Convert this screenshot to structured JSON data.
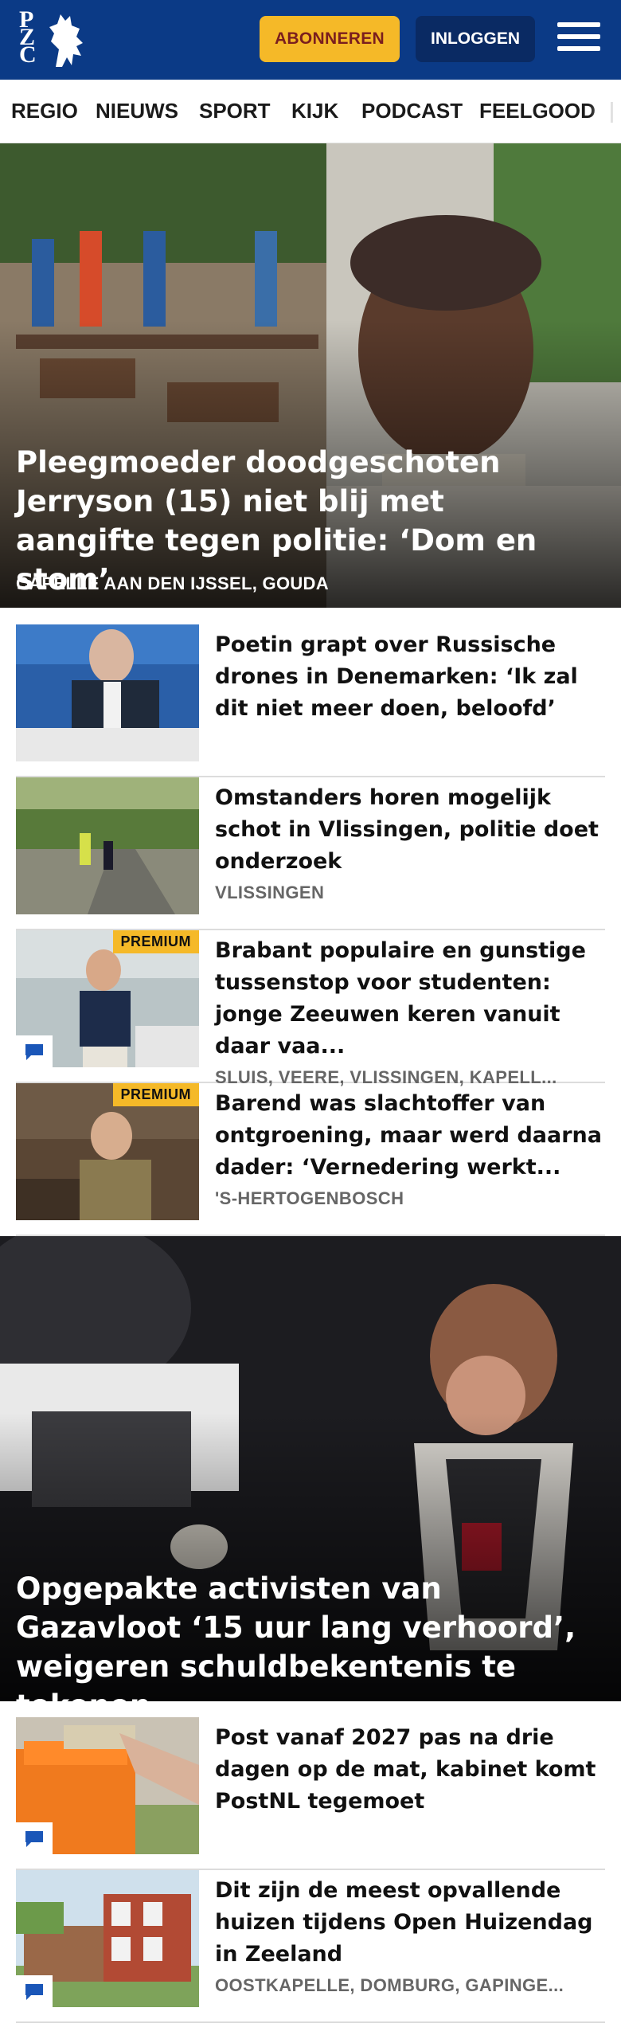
{
  "header": {
    "logo_text": "PZC",
    "subscribe_label": "ABONNEREN",
    "login_label": "INLOGGEN",
    "menu_icon": "hamburger-menu-icon",
    "colors": {
      "brand": "#0b3a86",
      "accent": "#f5b928"
    }
  },
  "nav": {
    "items": [
      "REGIO",
      "NIEUWS",
      "SPORT",
      "KIJK",
      "PODCAST",
      "FEELGOOD"
    ]
  },
  "hero1": {
    "headline": "Pleegmoeder doodgeschoten Jerryson (15) niet blij met aangifte tegen politie: ‘Dom en stom’",
    "location": "CAPELLE AAN DEN IJSSEL, GOUDA"
  },
  "articles": [
    {
      "title": "Poetin grapt over Russische drones in Denemarken: ‘Ik zal dit niet meer doen, beloofd’",
      "location": "",
      "premium": "",
      "comments": false
    },
    {
      "title": "Omstanders horen mogelijk schot in Vlissingen, politie doet onderzoek",
      "location": "VLISSINGEN",
      "premium": "",
      "comments": false
    },
    {
      "title": "Brabant populaire en gunstige tussenstop voor studenten: jonge Zeeuwen keren vanuit daar vaa...",
      "location": "SLUIS, VEERE, VLISSINGEN, KAPELL...",
      "premium": "PREMIUM",
      "comments": true
    },
    {
      "title": "Barend was slachtoffer van ontgroening, maar werd daarna dader: ‘Vernedering werkt...",
      "location": "'S-HERTOGENBOSCH",
      "premium": "PREMIUM",
      "comments": false
    }
  ],
  "hero2": {
    "headline": "Opgepakte activisten van Gazavloot ‘15 uur lang verhoord’, weigeren schuldbekentenis te tekenen"
  },
  "articles2": [
    {
      "title": "Post vanaf 2027 pas na drie dagen op de mat, kabinet komt PostNL tegemoet",
      "location": "",
      "premium": "",
      "comments": true
    },
    {
      "title": "Dit zijn de meest opvallende huizen tijdens Open Huizendag in Zeeland",
      "location": "OOSTKAPELLE, DOMBURG, GAPINGE...",
      "premium": "",
      "comments": true
    }
  ]
}
